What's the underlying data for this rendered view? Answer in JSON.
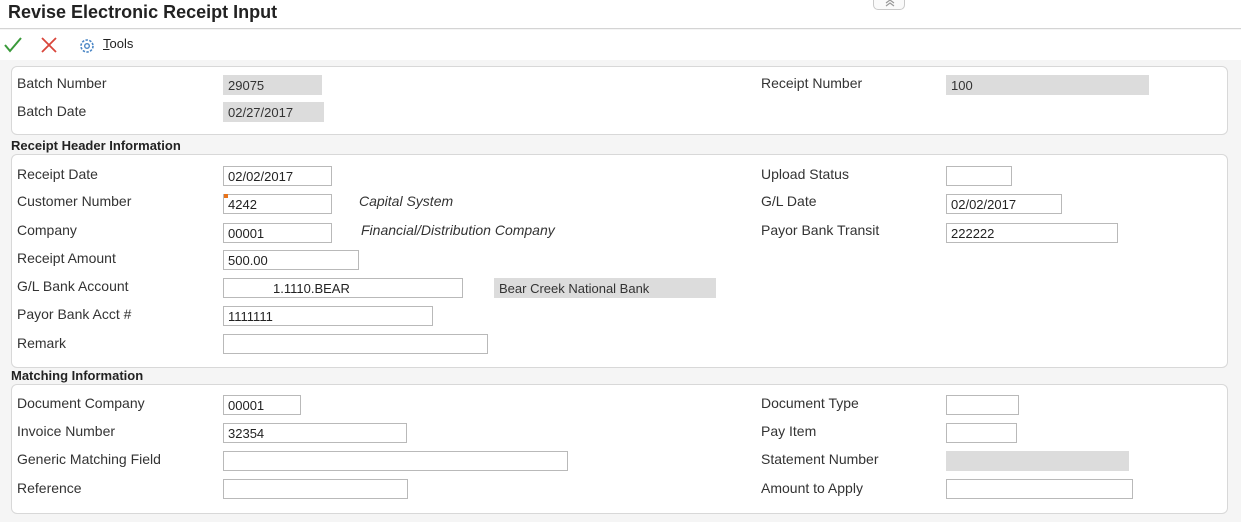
{
  "window": {
    "title": "Revise Electronic Receipt Input"
  },
  "toolbar": {
    "ok": "check-icon",
    "cancel": "x-icon",
    "tools_icon": "gear-icon",
    "tools_first": "T",
    "tools_rest": "ools"
  },
  "batch": {
    "batch_number_label": "Batch Number",
    "batch_number": "29075",
    "batch_date_label": "Batch Date",
    "batch_date": "02/27/2017",
    "receipt_number_label": "Receipt Number",
    "receipt_number": "100"
  },
  "receipt_header": {
    "section_title": "Receipt Header Information",
    "receipt_date_label": "Receipt Date",
    "receipt_date": "02/02/2017",
    "customer_number_label": "Customer Number",
    "customer_number": "4242",
    "customer_name": "Capital System",
    "company_label": "Company",
    "company": "00001",
    "company_name": "Financial/Distribution Company",
    "receipt_amount_label": "Receipt Amount",
    "receipt_amount": "500.00",
    "gl_bank_account_label": "G/L Bank Account",
    "gl_bank_account": "1.1110.BEAR",
    "gl_bank_name": "Bear Creek National Bank",
    "payor_bank_acct_label": "Payor Bank Acct #",
    "payor_bank_acct": "1111111",
    "remark_label": "Remark",
    "remark": "",
    "upload_status_label": "Upload Status",
    "upload_status": "",
    "gl_date_label": "G/L Date",
    "gl_date": "02/02/2017",
    "payor_bank_transit_label": "Payor Bank Transit",
    "payor_bank_transit": "222222"
  },
  "matching": {
    "section_title": "Matching Information",
    "document_company_label": "Document Company",
    "document_company": "00001",
    "invoice_number_label": "Invoice Number",
    "invoice_number": "32354",
    "generic_matching_label": "Generic Matching Field",
    "generic_matching": "",
    "reference_label": "Reference",
    "reference": "",
    "document_type_label": "Document Type",
    "document_type": "",
    "pay_item_label": "Pay Item",
    "pay_item": "",
    "statement_number_label": "Statement Number",
    "statement_number": "",
    "amount_to_apply_label": "Amount to Apply",
    "amount_to_apply": ""
  },
  "colors": {
    "ok_green": "#3a9a3a",
    "cancel_red": "#d9463b",
    "required_marker": "#e8731a",
    "readonly_bg": "#dcdcdc"
  }
}
